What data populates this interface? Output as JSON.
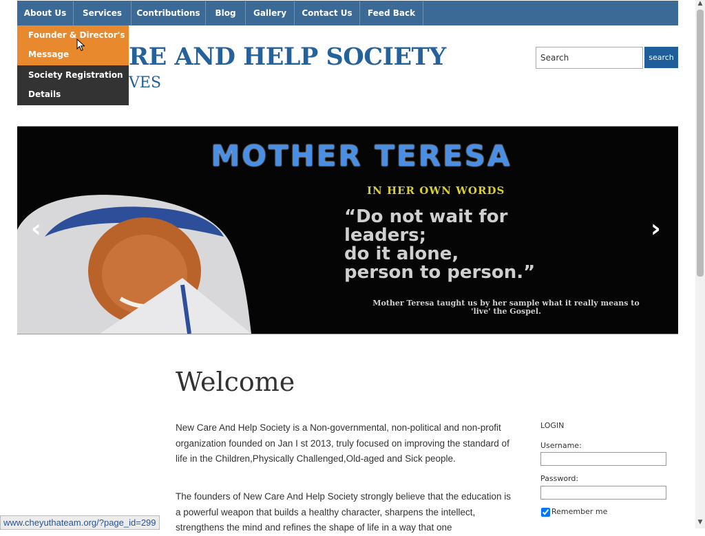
{
  "nav": {
    "items": [
      {
        "label": "About Us"
      },
      {
        "label": "Services"
      },
      {
        "label": "Contributions"
      },
      {
        "label": "Blog"
      },
      {
        "label": "Gallery"
      },
      {
        "label": "Contact Us"
      },
      {
        "label": "Feed Back"
      }
    ],
    "dropdown": [
      {
        "line1": "Founder & Director's",
        "line2": "Message"
      },
      {
        "line1": "Society Registration",
        "line2": "Details"
      }
    ]
  },
  "header": {
    "title_visible": "RE AND HELP SOCIETY",
    "tagline_visible": "VES"
  },
  "search": {
    "value": "Search",
    "button_label": "search"
  },
  "slider": {
    "title": "MOTHER TERESA",
    "subtitle": "IN HER OWN WORDS",
    "quote": "“Do not wait for\nleaders;\ndo it alone,\nperson to person.”",
    "caption": "Mother Teresa taught us by her sample what it really means to 'live' the Gospel.",
    "prev_icon": "chevron-left",
    "next_icon": "chevron-right"
  },
  "main": {
    "heading": "Welcome",
    "para1": "New Care And Help Society is a Non-governmental, non-political and non-profit organization founded on Jan I st 2013, truly focused on improving the standard of life in the Children,Physically Challenged,Old-aged and Sick people.",
    "para2": "The founders of New Care And Help Society strongly believe that the education is a powerful weapon that builds a healthy character, sharpens the intellect, strengthens the mind and refines the shape of life in a way that one"
  },
  "login": {
    "title": "LOGIN",
    "username_label": "Username:",
    "password_label": "Password:",
    "remember_label": "Remember me",
    "remember_checked": true
  },
  "statusbar": {
    "url": "www.cheyuthateam.org/?page_id=299"
  },
  "colors": {
    "nav_bg": "#3a6a95",
    "accent": "#e8892e",
    "title": "#25629c"
  }
}
